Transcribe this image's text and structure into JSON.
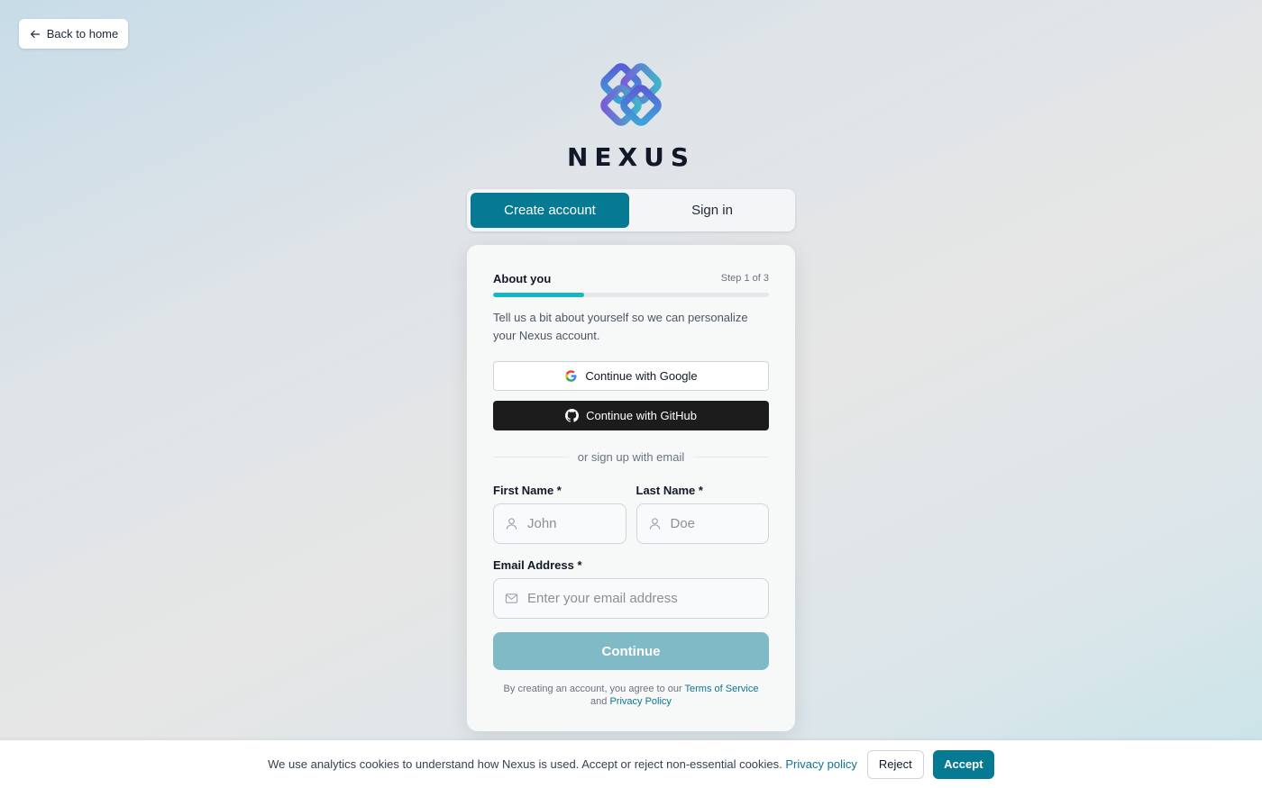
{
  "nav": {
    "back_label": "Back to home"
  },
  "brand": {
    "wordmark": "NEXUS",
    "accent_color": "#067a92"
  },
  "tabs": [
    {
      "label": "Create account",
      "active": true
    },
    {
      "label": "Sign in",
      "active": false
    }
  ],
  "form": {
    "step_title": "About you",
    "step_count": "Step 1 of 3",
    "progress_fraction": 0.33,
    "intro": "Tell us a bit about yourself so we can personalize your Nexus account.",
    "google_label": "Continue with Google",
    "github_label": "Continue with GitHub",
    "divider_label": "or sign up with email",
    "first_name": {
      "label": "First Name *",
      "placeholder": "John",
      "value": ""
    },
    "last_name": {
      "label": "Last Name *",
      "placeholder": "Doe",
      "value": ""
    },
    "email": {
      "label": "Email Address *",
      "placeholder": "Enter your email address",
      "value": ""
    },
    "continue_label": "Continue",
    "terms_prefix": "By creating an account, you agree to our",
    "terms_link": "Terms of Service",
    "terms_and": "and",
    "privacy_link": "Privacy Policy"
  },
  "cookie": {
    "text": "We use analytics cookies to understand how Nexus is used. Accept or reject non-essential cookies.",
    "privacy_link": "Privacy policy",
    "reject_label": "Reject",
    "accept_label": "Accept"
  }
}
